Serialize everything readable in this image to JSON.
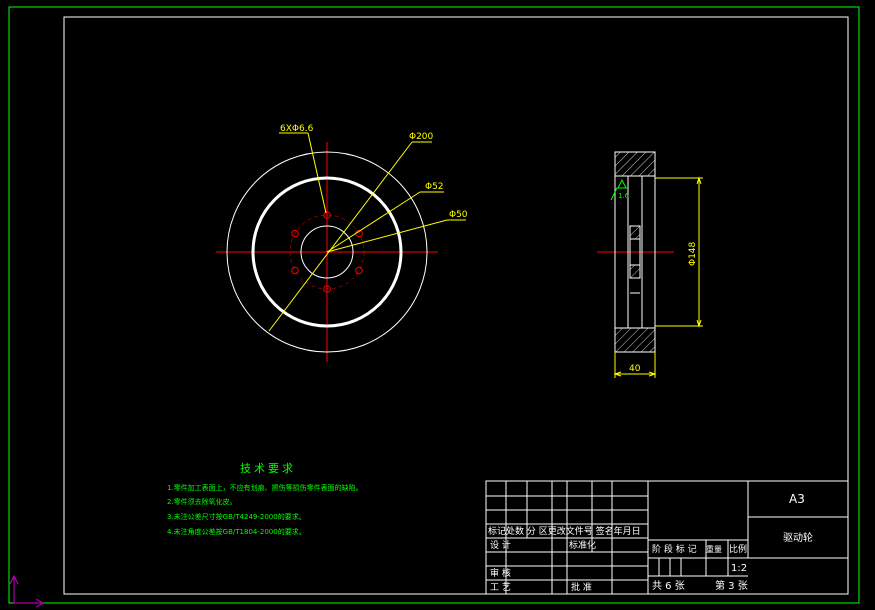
{
  "drawing": {
    "colors": {
      "background": "#000000",
      "frame": "#00ff00",
      "outline": "#ffffff",
      "dimension": "#ffff00",
      "centerline": "#ff0000",
      "notes": "#00ff00"
    },
    "front_view": {
      "labels": {
        "holes": "6XΦ6.6",
        "outer_diameter": "Φ200",
        "hub_diameter": "Φ52",
        "bore_diameter": "Φ50"
      }
    },
    "side_view": {
      "labels": {
        "height": "Φ148",
        "width": "40",
        "roughness": "1.6"
      }
    },
    "technical_requirements": {
      "title": "技术要求",
      "items": [
        "1.零件加工表面上，不应有划痕、擦伤等损伤零件表面的缺陷。",
        "2.零件须去除氧化皮。",
        "3.未注公差尺寸按GB/T4249-2000的要求。",
        "4.未注角度公差按GB/T1804-2000的要求。"
      ]
    },
    "title_block": {
      "sheet_size": "A3",
      "part_name": "驱动轮",
      "revision_header": "标记处数 分 区更改文件号 签名年月日",
      "designer_label": "设 计",
      "standardization_label": "标准化",
      "checker_label": "审 核",
      "process_label": "工 艺",
      "approval_label": "批 准",
      "stage_label": "阶 段 标 记",
      "weight_label": "重量",
      "scale_label": "比例",
      "scale_value": "1:2",
      "total_sheets": "共 6 张",
      "sheet_number": "第 3 张"
    }
  }
}
